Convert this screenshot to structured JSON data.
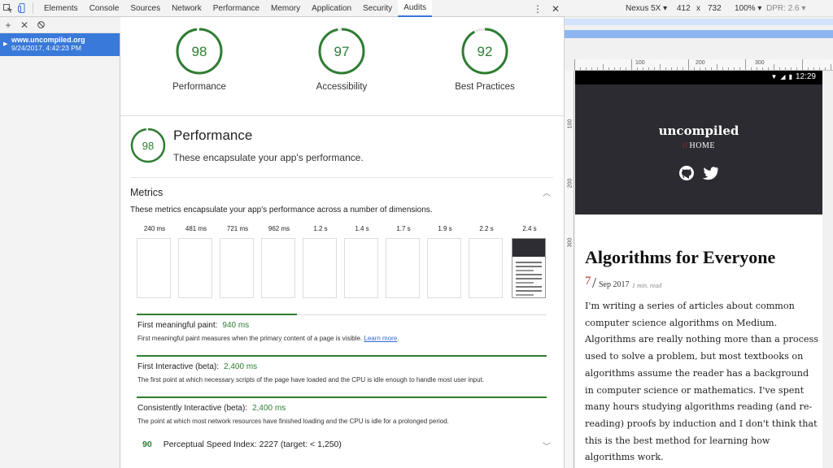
{
  "devtools": {
    "tabs": [
      "Elements",
      "Console",
      "Sources",
      "Network",
      "Performance",
      "Memory",
      "Application",
      "Security",
      "Audits"
    ],
    "active_tab": "Audits",
    "icons": [
      "inspect-icon",
      "device-toggle-icon",
      "more-vert-icon",
      "close-icon"
    ]
  },
  "runbar": {
    "icons": [
      "add-icon",
      "clear-icon",
      "block-icon"
    ]
  },
  "sidebar": {
    "runs": [
      {
        "site": "www.uncompiled.org",
        "date": "9/24/2017, 4:42:23 PM"
      }
    ]
  },
  "report": {
    "gauges": [
      {
        "score": "98",
        "label": "Performance",
        "fraction": 0.98
      },
      {
        "score": "97",
        "label": "Accessibility",
        "fraction": 0.97
      },
      {
        "score": "92",
        "label": "Best Practices",
        "fraction": 0.92
      }
    ],
    "section": {
      "score": "98",
      "title": "Performance",
      "description": "These encapsulate your app's performance."
    },
    "metrics": {
      "title": "Metrics",
      "description": "These metrics encapsulate your app's performance across a number of dimensions.",
      "filmstrip": [
        "240 ms",
        "481 ms",
        "721 ms",
        "962 ms",
        "1.2 s",
        "1.4 s",
        "1.7 s",
        "1.9 s",
        "2.2 s",
        "2.4 s"
      ],
      "items": [
        {
          "name": "First meaningful paint:",
          "value": "940 ms",
          "description": "First meaningful paint measures when the primary content of a page is visible.",
          "link": "Learn more",
          "timeline_fraction": 0.39
        },
        {
          "name": "First Interactive (beta):",
          "value": "2,400 ms",
          "description": "The first point at which necessary scripts of the page have loaded and the CPU is idle enough to handle most user input.",
          "timeline_fraction": 1.0
        },
        {
          "name": "Consistently Interactive (beta):",
          "value": "2,400 ms",
          "description": "The point at which most network resources have finished loading and the CPU is idle for a prolonged period.",
          "timeline_fraction": 1.0
        }
      ],
      "speed_index": {
        "score": "90",
        "label": "Perceptual Speed Index: 2227 (target: < 1,250)"
      }
    }
  },
  "device": {
    "name": "Nexus 5X",
    "width": "412",
    "times": "x",
    "height": "732",
    "zoom": "100%",
    "dpr": "DPR: 2.6",
    "ruler_labels": [
      "100",
      "200",
      "300"
    ],
    "status_time": "12:29",
    "site": {
      "brand": "uncompiled",
      "home_slashes": "//",
      "home": "HOME",
      "social": [
        "github-icon",
        "twitter-icon"
      ],
      "article_title": "Algorithms for Everyone",
      "day": "7",
      "slash": "/",
      "month": "Sep 2017",
      "read_time": "1 min. read",
      "body_lines": [
        "I'm writing a series of articles about common",
        "computer science algorithms on Medium.",
        "Algorithms are really nothing more than a process",
        "used to solve a problem, but most textbooks on",
        "algorithms assume the reader has a background",
        "in computer science or mathematics. I've spent",
        "many hours studying algorithms reading (and re-",
        "reading) proofs by induction and I don't think that",
        "this is the best method for learning how",
        "algorithms work."
      ]
    }
  },
  "colors": {
    "accent": "#3879d9",
    "pass": "#2e7d32",
    "hero": "#2b2b31"
  }
}
